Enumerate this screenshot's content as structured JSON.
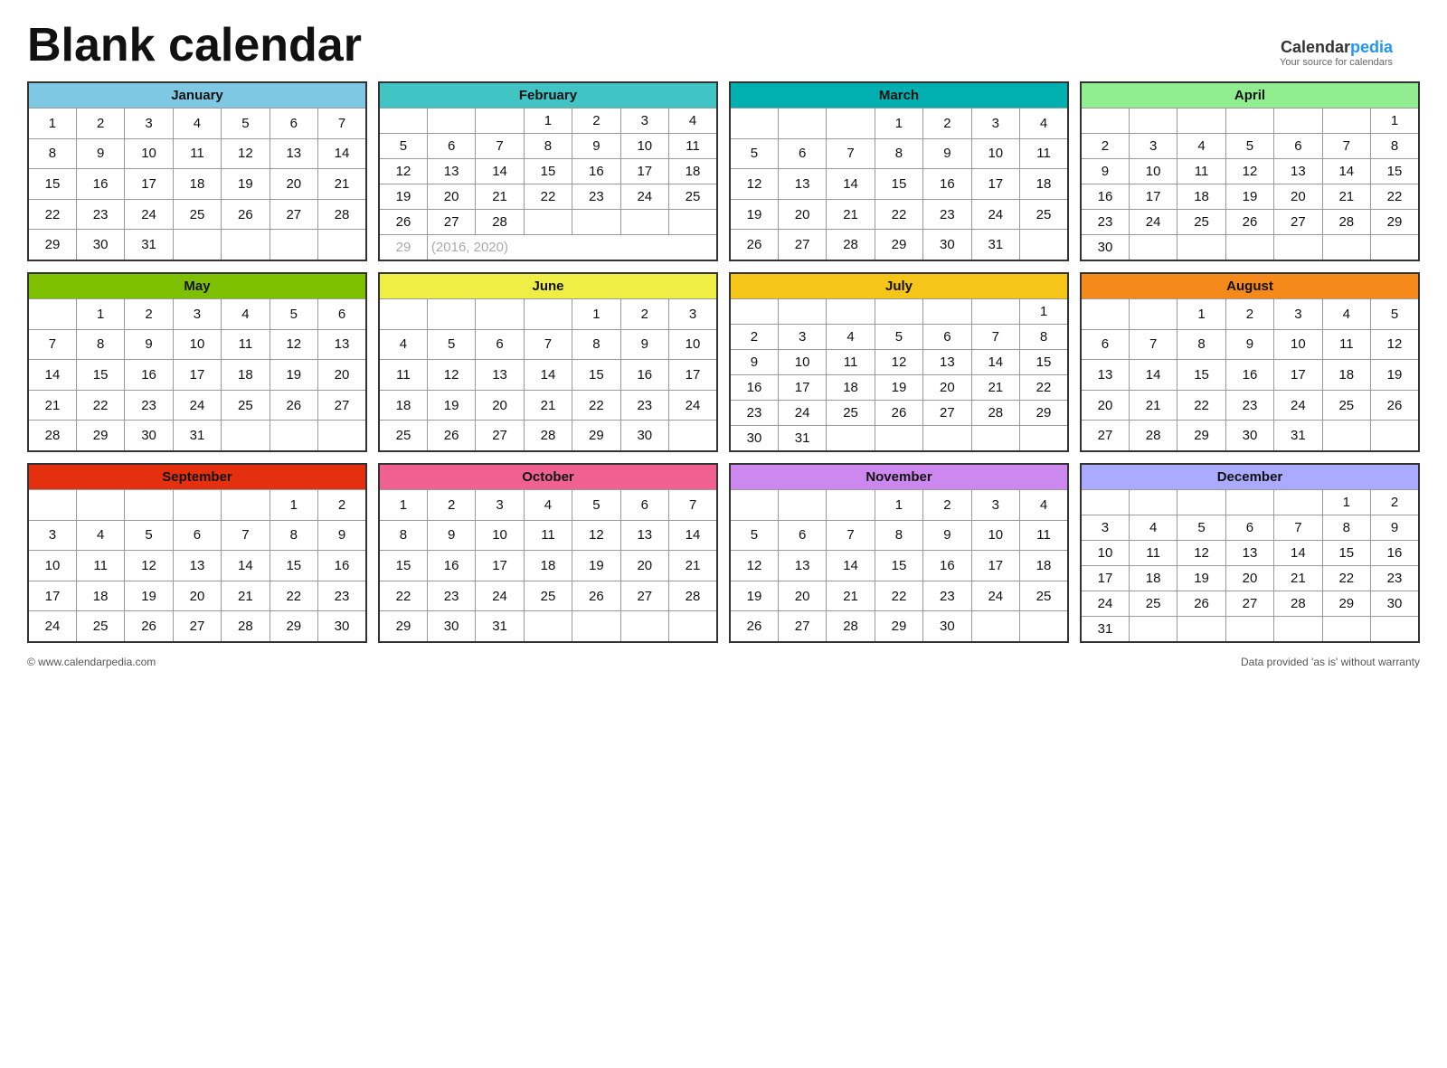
{
  "title": "Blank calendar",
  "brand": {
    "calendar": "Calendar",
    "pedia": "pedia",
    "tagline": "Your source for calendars"
  },
  "footer": {
    "left": "© www.calendarpedia.com",
    "right": "Data provided 'as is' without warranty"
  },
  "months": [
    {
      "name": "January",
      "color": "#7EC8E3",
      "days": 31,
      "startDay": 0,
      "extraNote": null
    },
    {
      "name": "February",
      "color": "#40C4C4",
      "days": 28,
      "startDay": 3,
      "extraNote": "29  (2016, 2020)"
    },
    {
      "name": "March",
      "color": "#00B0B0",
      "days": 31,
      "startDay": 3,
      "extraNote": null
    },
    {
      "name": "April",
      "color": "#90EE90",
      "days": 30,
      "startDay": 6,
      "extraNote": null
    },
    {
      "name": "May",
      "color": "#7DC000",
      "days": 31,
      "startDay": 1,
      "extraNote": null
    },
    {
      "name": "June",
      "color": "#EEEE44",
      "days": 30,
      "startDay": 4,
      "extraNote": null
    },
    {
      "name": "July",
      "color": "#F5C518",
      "days": 31,
      "startDay": 6,
      "extraNote": null
    },
    {
      "name": "August",
      "color": "#F5891A",
      "days": 31,
      "startDay": 2,
      "extraNote": null
    },
    {
      "name": "September",
      "color": "#E53010",
      "days": 30,
      "startDay": 5,
      "extraNote": null
    },
    {
      "name": "October",
      "color": "#F06090",
      "days": 31,
      "startDay": 0,
      "extraNote": null
    },
    {
      "name": "November",
      "color": "#CC88EE",
      "days": 30,
      "startDay": 3,
      "extraNote": null
    },
    {
      "name": "December",
      "color": "#AAAAFF",
      "days": 31,
      "startDay": 5,
      "extraNote": null
    }
  ]
}
